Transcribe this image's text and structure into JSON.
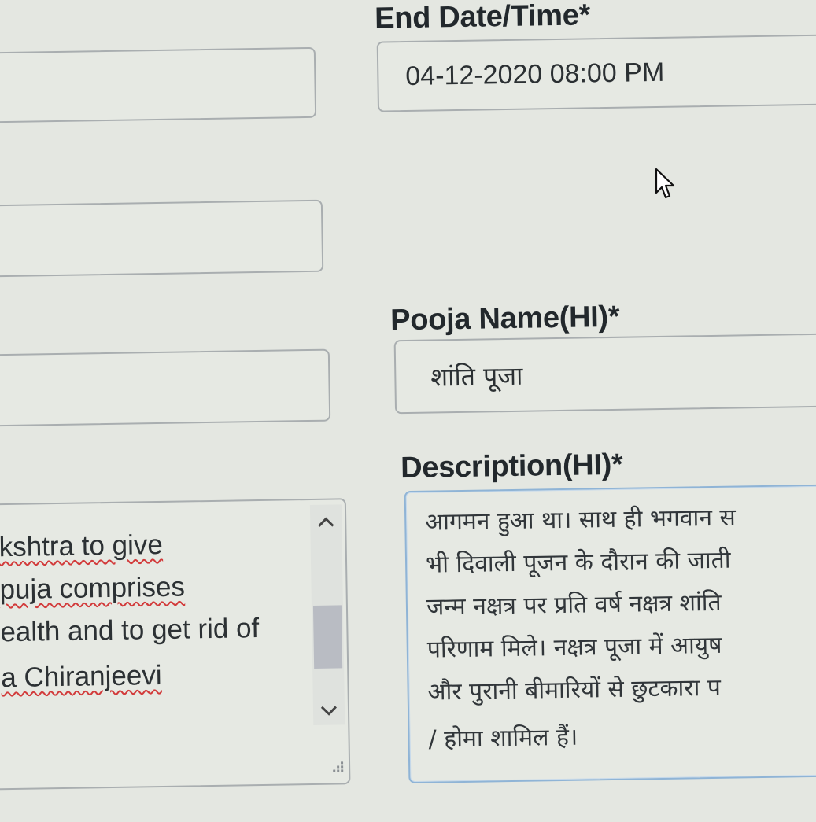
{
  "fields": {
    "end_datetime": {
      "label": "End Date/Time*",
      "value": "04-12-2020 08:00 PM"
    },
    "pooja_name_hi": {
      "label": "Pooja Name(HI)*",
      "value": "शांति पूजा"
    },
    "description_hi": {
      "label": "Description(HI)*",
      "lines": [
        "आगमन हुआ था। साथ ही भगवान स",
        "भी दिवाली पूजन के दौरान की जाती",
        "जन्म नक्षत्र पर प्रति वर्ष नक्षत्र शांति",
        "परिणाम मिले। नक्षत्र पूजा में आयुष",
        "और पुरानी बीमारियों से छुटकारा प",
        "/ होमा शामिल हैं।"
      ]
    },
    "description_en": {
      "lines": [
        "kshtra to give",
        "puja comprises",
        "ealth and to get rid of",
        "a Chiranjeevi"
      ]
    }
  },
  "icons": {
    "scroll_up": "chevron-up-icon",
    "scroll_down": "chevron-down-icon",
    "resize": "resize-grip-icon",
    "cursor": "mouse-pointer-icon"
  }
}
